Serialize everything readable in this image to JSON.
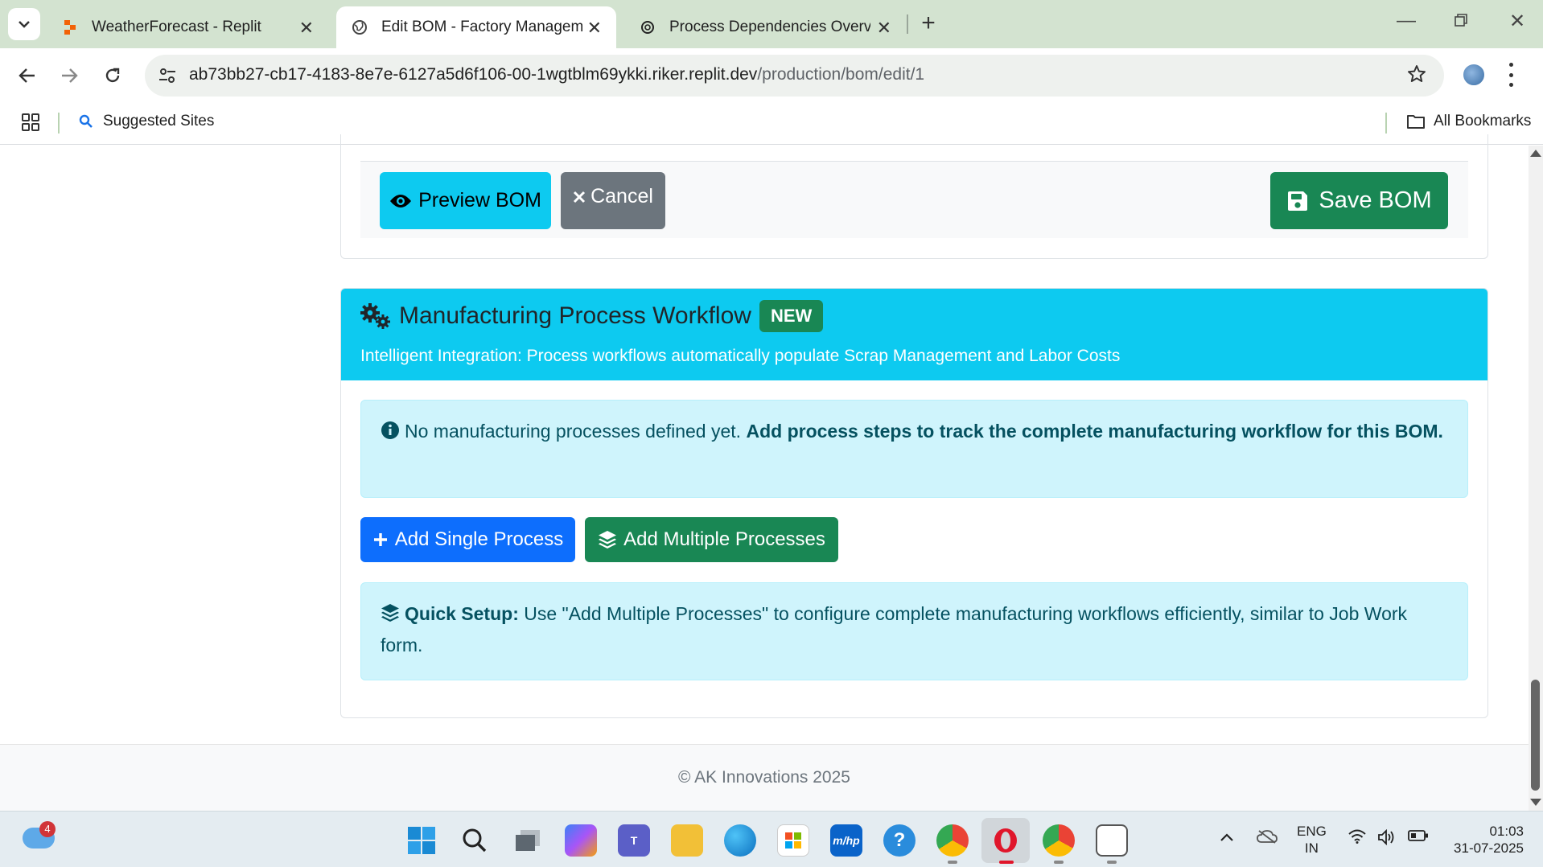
{
  "browser": {
    "tabs": [
      {
        "title": "WeatherForecast - Replit",
        "active": false
      },
      {
        "title": "Edit BOM - Factory Management",
        "active": true
      },
      {
        "title": "Process Dependencies Overview",
        "active": false
      }
    ],
    "url_host": "ab73bb27-cb17-4183-8e7e-6127a5d6f106-00-1wgtblm69ykki.riker.replit.dev",
    "url_path": "/production/bom/edit/1",
    "bookmarks": {
      "suggested": "Suggested Sites",
      "all": "All Bookmarks"
    }
  },
  "bom_actions": {
    "preview_label": "Preview BOM",
    "cancel_label": "Cancel",
    "save_label": "Save BOM"
  },
  "workflow": {
    "title": "Manufacturing Process Workflow",
    "badge": "NEW",
    "subtitle": "Intelligent Integration: Process workflows automatically populate Scrap Management and Labor Costs",
    "empty_notice": "No manufacturing processes defined yet.",
    "empty_notice_bold": "Add process steps to track the complete manufacturing workflow for this BOM.",
    "add_single_label": "Add Single Process",
    "add_multiple_label": "Add Multiple Processes",
    "quick_setup_label": "Quick Setup:",
    "quick_setup_text": "Use \"Add Multiple Processes\" to configure complete manufacturing workflows efficiently, similar to Job Work form."
  },
  "footer": {
    "copyright": "© AK Innovations 2025"
  },
  "taskbar": {
    "weather_badge": "4",
    "lang_line1": "ENG",
    "lang_line2": "IN",
    "time": "01:03",
    "date": "31-07-2025"
  },
  "colors": {
    "info": "#0dcaf0",
    "success": "#198754",
    "primary": "#0d6efd",
    "secondary": "#6c757d",
    "alert_bg": "#cff4fc"
  }
}
